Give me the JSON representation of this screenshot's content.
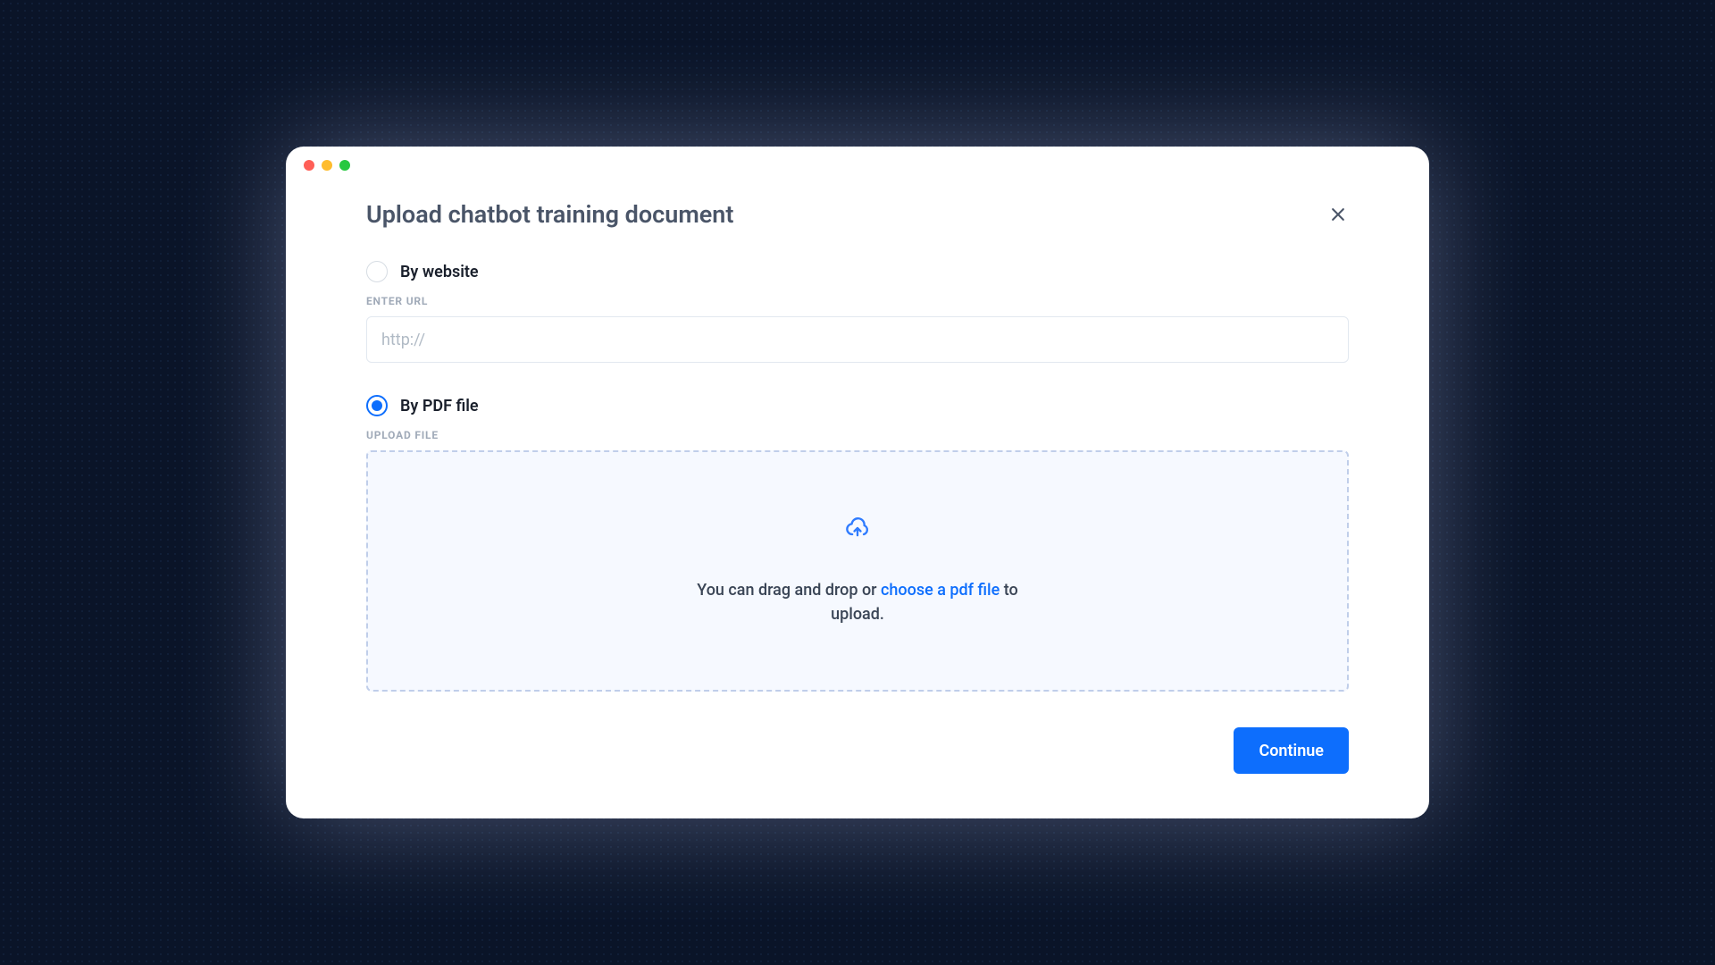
{
  "modal": {
    "title": "Upload chatbot training document",
    "options": {
      "website": {
        "label": "By website",
        "selected": false,
        "field_label": "ENTER URL",
        "placeholder": "http://"
      },
      "pdf": {
        "label": "By PDF file",
        "selected": true,
        "field_label": "UPLOAD FILE",
        "dropzone_prefix": "You can drag and drop or ",
        "dropzone_link": "choose a pdf file",
        "dropzone_suffix": " to upload."
      }
    },
    "continue_label": "Continue"
  }
}
